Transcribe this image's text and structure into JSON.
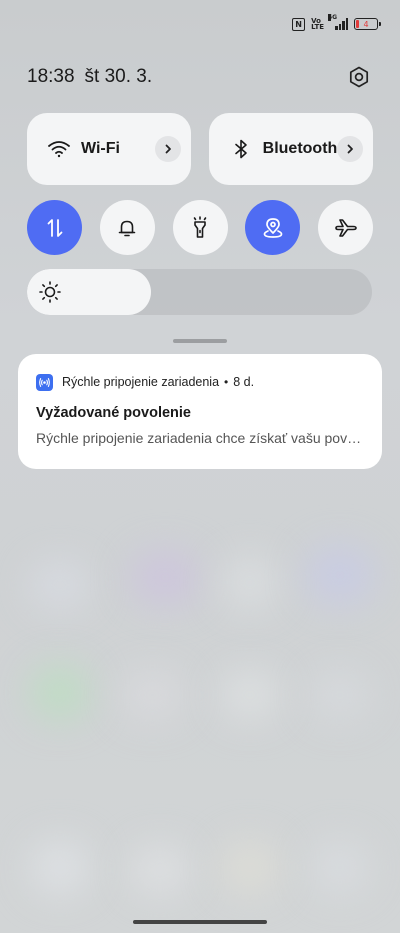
{
  "status_bar": {
    "nfc_icon": "nfc-icon",
    "volte_text": "Vo LTE",
    "network_label": "5G",
    "battery_level": "4",
    "battery_color": "#e23b3b"
  },
  "header": {
    "time": "18:38",
    "date": "št 30. 3.",
    "settings_icon": "gear-icon"
  },
  "tiles": [
    {
      "label": "Wi-Fi",
      "icon": "wifi-icon"
    },
    {
      "label": "Bluetooth",
      "icon": "bluetooth-icon"
    }
  ],
  "toggles": [
    {
      "name": "mobile-data",
      "icon": "data-arrows-icon",
      "active": true
    },
    {
      "name": "sound",
      "icon": "bell-icon",
      "active": false
    },
    {
      "name": "flashlight",
      "icon": "flashlight-icon",
      "active": false
    },
    {
      "name": "location",
      "icon": "location-icon",
      "active": true
    },
    {
      "name": "airplane-mode",
      "icon": "airplane-icon",
      "active": false
    }
  ],
  "brightness": {
    "level": 0.36,
    "icon": "sun-icon"
  },
  "notification": {
    "app_name": "Rýchle pripojenie zariadenia",
    "separator": "•",
    "age": "8 d.",
    "title": "Vyžadované povolenie",
    "body": "Rýchle pripojenie zariadenia chce získať vašu povolenie"
  },
  "colors": {
    "accent": "#4f6cf3",
    "tile_bg": "#f4f5f6",
    "app_icon": "#3d6ff0"
  }
}
